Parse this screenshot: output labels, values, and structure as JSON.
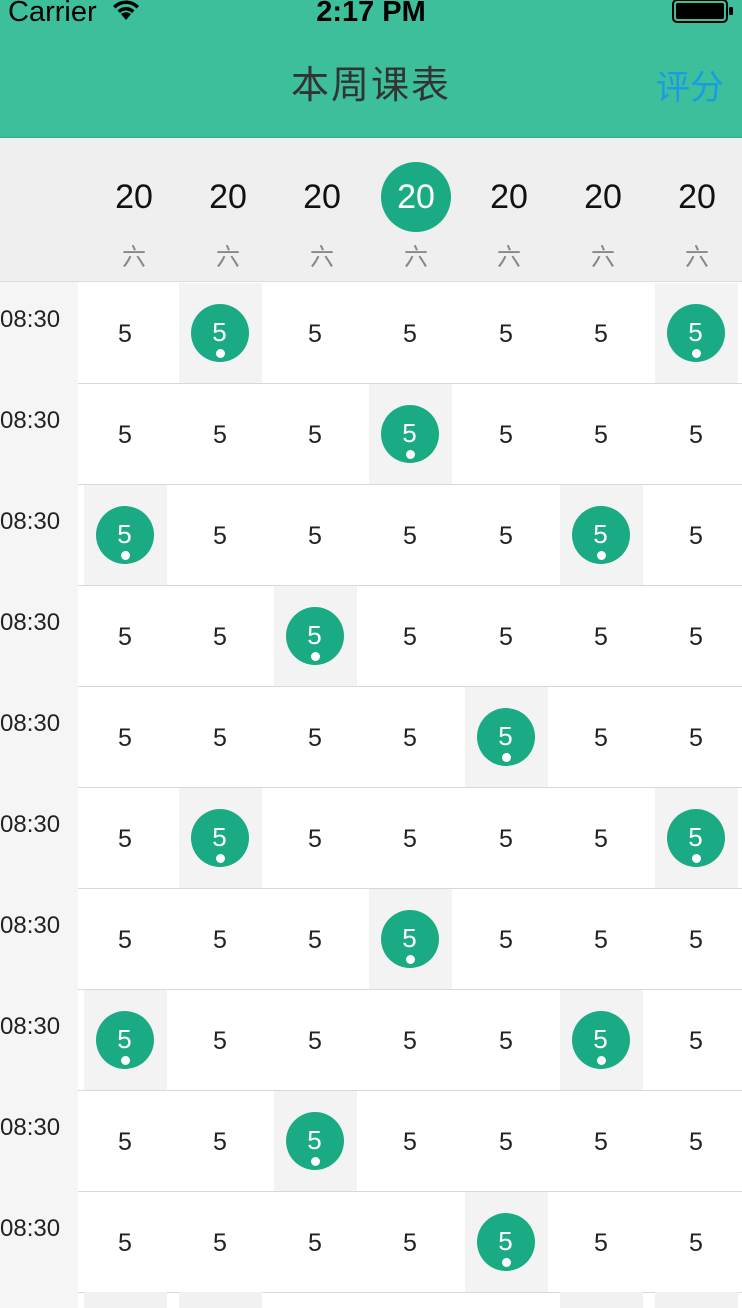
{
  "status_bar": {
    "carrier": "Carrier",
    "time": "2:17 PM"
  },
  "nav": {
    "title": "本周课表",
    "right_button": "评分"
  },
  "day_header": {
    "selected_index": 3,
    "days": [
      {
        "date": "20",
        "weekday": "六"
      },
      {
        "date": "20",
        "weekday": "六"
      },
      {
        "date": "20",
        "weekday": "六"
      },
      {
        "date": "20",
        "weekday": "六"
      },
      {
        "date": "20",
        "weekday": "六"
      },
      {
        "date": "20",
        "weekday": "六"
      },
      {
        "date": "20",
        "weekday": "六"
      }
    ]
  },
  "schedule": {
    "rows": [
      {
        "time": "08:30",
        "cells": [
          "5",
          "5",
          "5",
          "5",
          "5",
          "5",
          "5"
        ],
        "marked": [
          1,
          6
        ]
      },
      {
        "time": "08:30",
        "cells": [
          "5",
          "5",
          "5",
          "5",
          "5",
          "5",
          "5"
        ],
        "marked": [
          3
        ]
      },
      {
        "time": "08:30",
        "cells": [
          "5",
          "5",
          "5",
          "5",
          "5",
          "5",
          "5"
        ],
        "marked": [
          0,
          5
        ]
      },
      {
        "time": "08:30",
        "cells": [
          "5",
          "5",
          "5",
          "5",
          "5",
          "5",
          "5"
        ],
        "marked": [
          2
        ]
      },
      {
        "time": "08:30",
        "cells": [
          "5",
          "5",
          "5",
          "5",
          "5",
          "5",
          "5"
        ],
        "marked": [
          4
        ]
      },
      {
        "time": "08:30",
        "cells": [
          "5",
          "5",
          "5",
          "5",
          "5",
          "5",
          "5"
        ],
        "marked": [
          1,
          6
        ]
      },
      {
        "time": "08:30",
        "cells": [
          "5",
          "5",
          "5",
          "5",
          "5",
          "5",
          "5"
        ],
        "marked": [
          3
        ]
      },
      {
        "time": "08:30",
        "cells": [
          "5",
          "5",
          "5",
          "5",
          "5",
          "5",
          "5"
        ],
        "marked": [
          0,
          5
        ]
      },
      {
        "time": "08:30",
        "cells": [
          "5",
          "5",
          "5",
          "5",
          "5",
          "5",
          "5"
        ],
        "marked": [
          2
        ]
      },
      {
        "time": "08:30",
        "cells": [
          "5",
          "5",
          "5",
          "5",
          "5",
          "5",
          "5"
        ],
        "marked": [
          4
        ]
      }
    ]
  },
  "colors": {
    "nav_bar": "#3dbf9b",
    "accent_green": "#1aab84",
    "right_button": "#1a9be6",
    "header_bg": "#efefef"
  }
}
